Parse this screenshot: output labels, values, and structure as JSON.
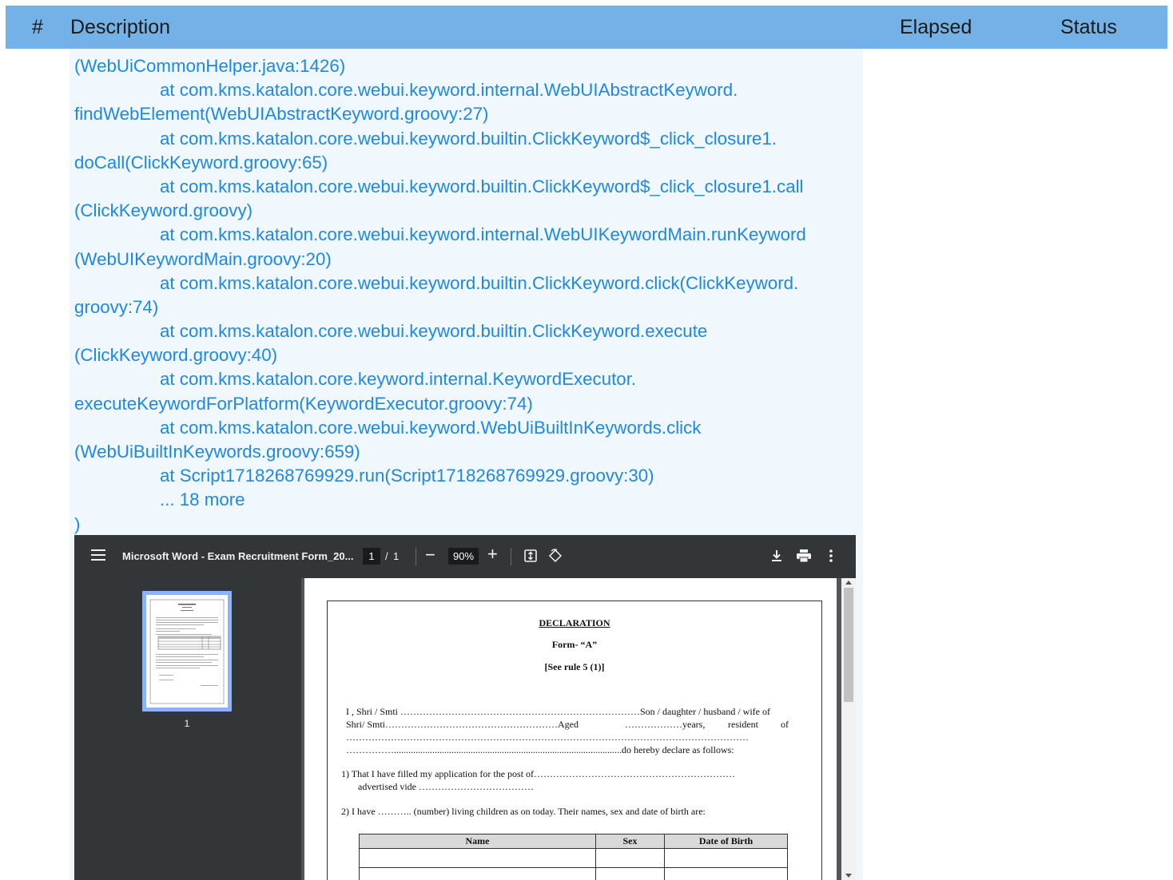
{
  "header": {
    "num": "#",
    "description": "Description",
    "elapsed": "Elapsed",
    "status": "Status"
  },
  "log_lines": [
    "(WebUiCommonHelper.java:1426)",
    "at com.kms.katalon.core.webui.keyword.internal.WebUIAbstractKeyword.",
    "findWebElement(WebUIAbstractKeyword.groovy:27)",
    "at com.kms.katalon.core.webui.keyword.builtin.ClickKeyword$_click_closure1.",
    "doCall(ClickKeyword.groovy:65)",
    "at com.kms.katalon.core.webui.keyword.builtin.ClickKeyword$_click_closure1.call",
    "(ClickKeyword.groovy)",
    "at com.kms.katalon.core.webui.keyword.internal.WebUIKeywordMain.runKeyword",
    "(WebUIKeywordMain.groovy:20)",
    "at com.kms.katalon.core.webui.keyword.builtin.ClickKeyword.click(ClickKeyword.",
    "groovy:74)",
    "at com.kms.katalon.core.webui.keyword.builtin.ClickKeyword.execute",
    "(ClickKeyword.groovy:40)",
    "at com.kms.katalon.core.keyword.internal.KeywordExecutor.",
    "executeKeywordForPlatform(KeywordExecutor.groovy:74)",
    "at com.kms.katalon.core.webui.keyword.WebUiBuiltInKeywords.click",
    "(WebUiBuiltInKeywords.groovy:659)",
    "at Script1718268769929.run(Script1718268769929.groovy:30)",
    "... 18 more",
    ")"
  ],
  "pdf_viewer": {
    "title": "Microsoft Word - Exam Recruitment Form_20...",
    "page_current": "1",
    "page_separator": "/",
    "page_total": "1",
    "zoom_minus": "−",
    "zoom": "90%",
    "zoom_plus": "+",
    "thumbnail_label": "1",
    "icons": [
      "menu-icon",
      "fit-page-icon",
      "rotate-icon",
      "download-icon",
      "print-icon",
      "more-icon"
    ]
  },
  "document": {
    "heading": "DECLARATION",
    "form": "Form- “A”",
    "rule": "[See rule 5 (1)]",
    "line1_left": "I , Shri / Smti …………………………………………………………………Son / daughter / husband / wife of",
    "line2_a": "Shri/   Smti………………………………………………Aged",
    "line2_b": "………………years,",
    "line2_c": "resident",
    "line2_d": "of",
    "line3": "………………………………………………………………………………………………………………",
    "line4": "……………...............................................................................................do hereby declare as follows:",
    "item1_a": "1)   That I have filled my application for the post of………………………………………………………",
    "item1_b": "advertised vide ………………………………",
    "item2": "2)   I have ……….. (number) living children as on today. Their names, sex and date of birth are:",
    "table_headers": [
      "Name",
      "Sex",
      "Date of Birth"
    ]
  }
}
